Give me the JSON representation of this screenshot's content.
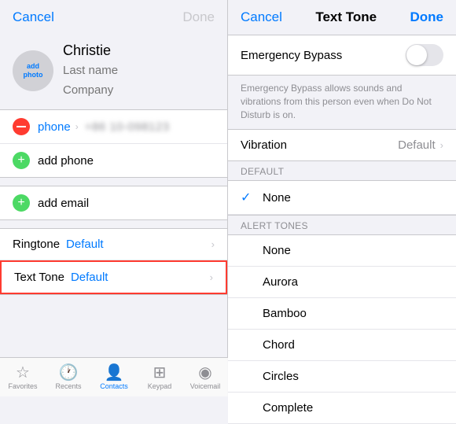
{
  "left": {
    "nav": {
      "cancel": "Cancel",
      "done": "Done"
    },
    "addPhoto": {
      "line1": "add",
      "line2": "photo"
    },
    "contact": {
      "firstName": "Christie",
      "lastName": "Last name",
      "company": "Company"
    },
    "phone": {
      "label": "phone",
      "arrow": "›",
      "number": "+86 10-098123"
    },
    "addPhone": "add phone",
    "addEmail": "add email",
    "ringtone": {
      "label": "Ringtone",
      "value": "Default",
      "arrow": "›"
    },
    "textTone": {
      "label": "Text Tone",
      "value": "Default",
      "arrow": "›"
    },
    "tabs": [
      {
        "icon": "★",
        "label": "Favorites",
        "active": false
      },
      {
        "icon": "🕐",
        "label": "Recents",
        "active": false
      },
      {
        "icon": "👤",
        "label": "Contacts",
        "active": true
      },
      {
        "icon": "⌨",
        "label": "Keypad",
        "active": false
      },
      {
        "icon": "📳",
        "label": "Voicemail",
        "active": false
      }
    ]
  },
  "right": {
    "nav": {
      "cancel": "Cancel",
      "title": "Text Tone",
      "done": "Done"
    },
    "emergencyBypass": {
      "label": "Emergency Bypass",
      "description": "Emergency Bypass allows sounds and vibrations from this person even when Do Not Disturb is on."
    },
    "vibration": {
      "label": "Vibration",
      "value": "Default",
      "arrow": "›"
    },
    "defaultSection": {
      "header": "DEFAULT",
      "items": [
        {
          "name": "None",
          "checked": true
        }
      ]
    },
    "alertSection": {
      "header": "ALERT TONES",
      "items": [
        {
          "name": "None",
          "checked": false
        },
        {
          "name": "Aurora",
          "checked": false
        },
        {
          "name": "Bamboo",
          "checked": false
        },
        {
          "name": "Chord",
          "checked": false
        },
        {
          "name": "Circles",
          "checked": false
        },
        {
          "name": "Complete",
          "checked": false
        }
      ]
    }
  }
}
